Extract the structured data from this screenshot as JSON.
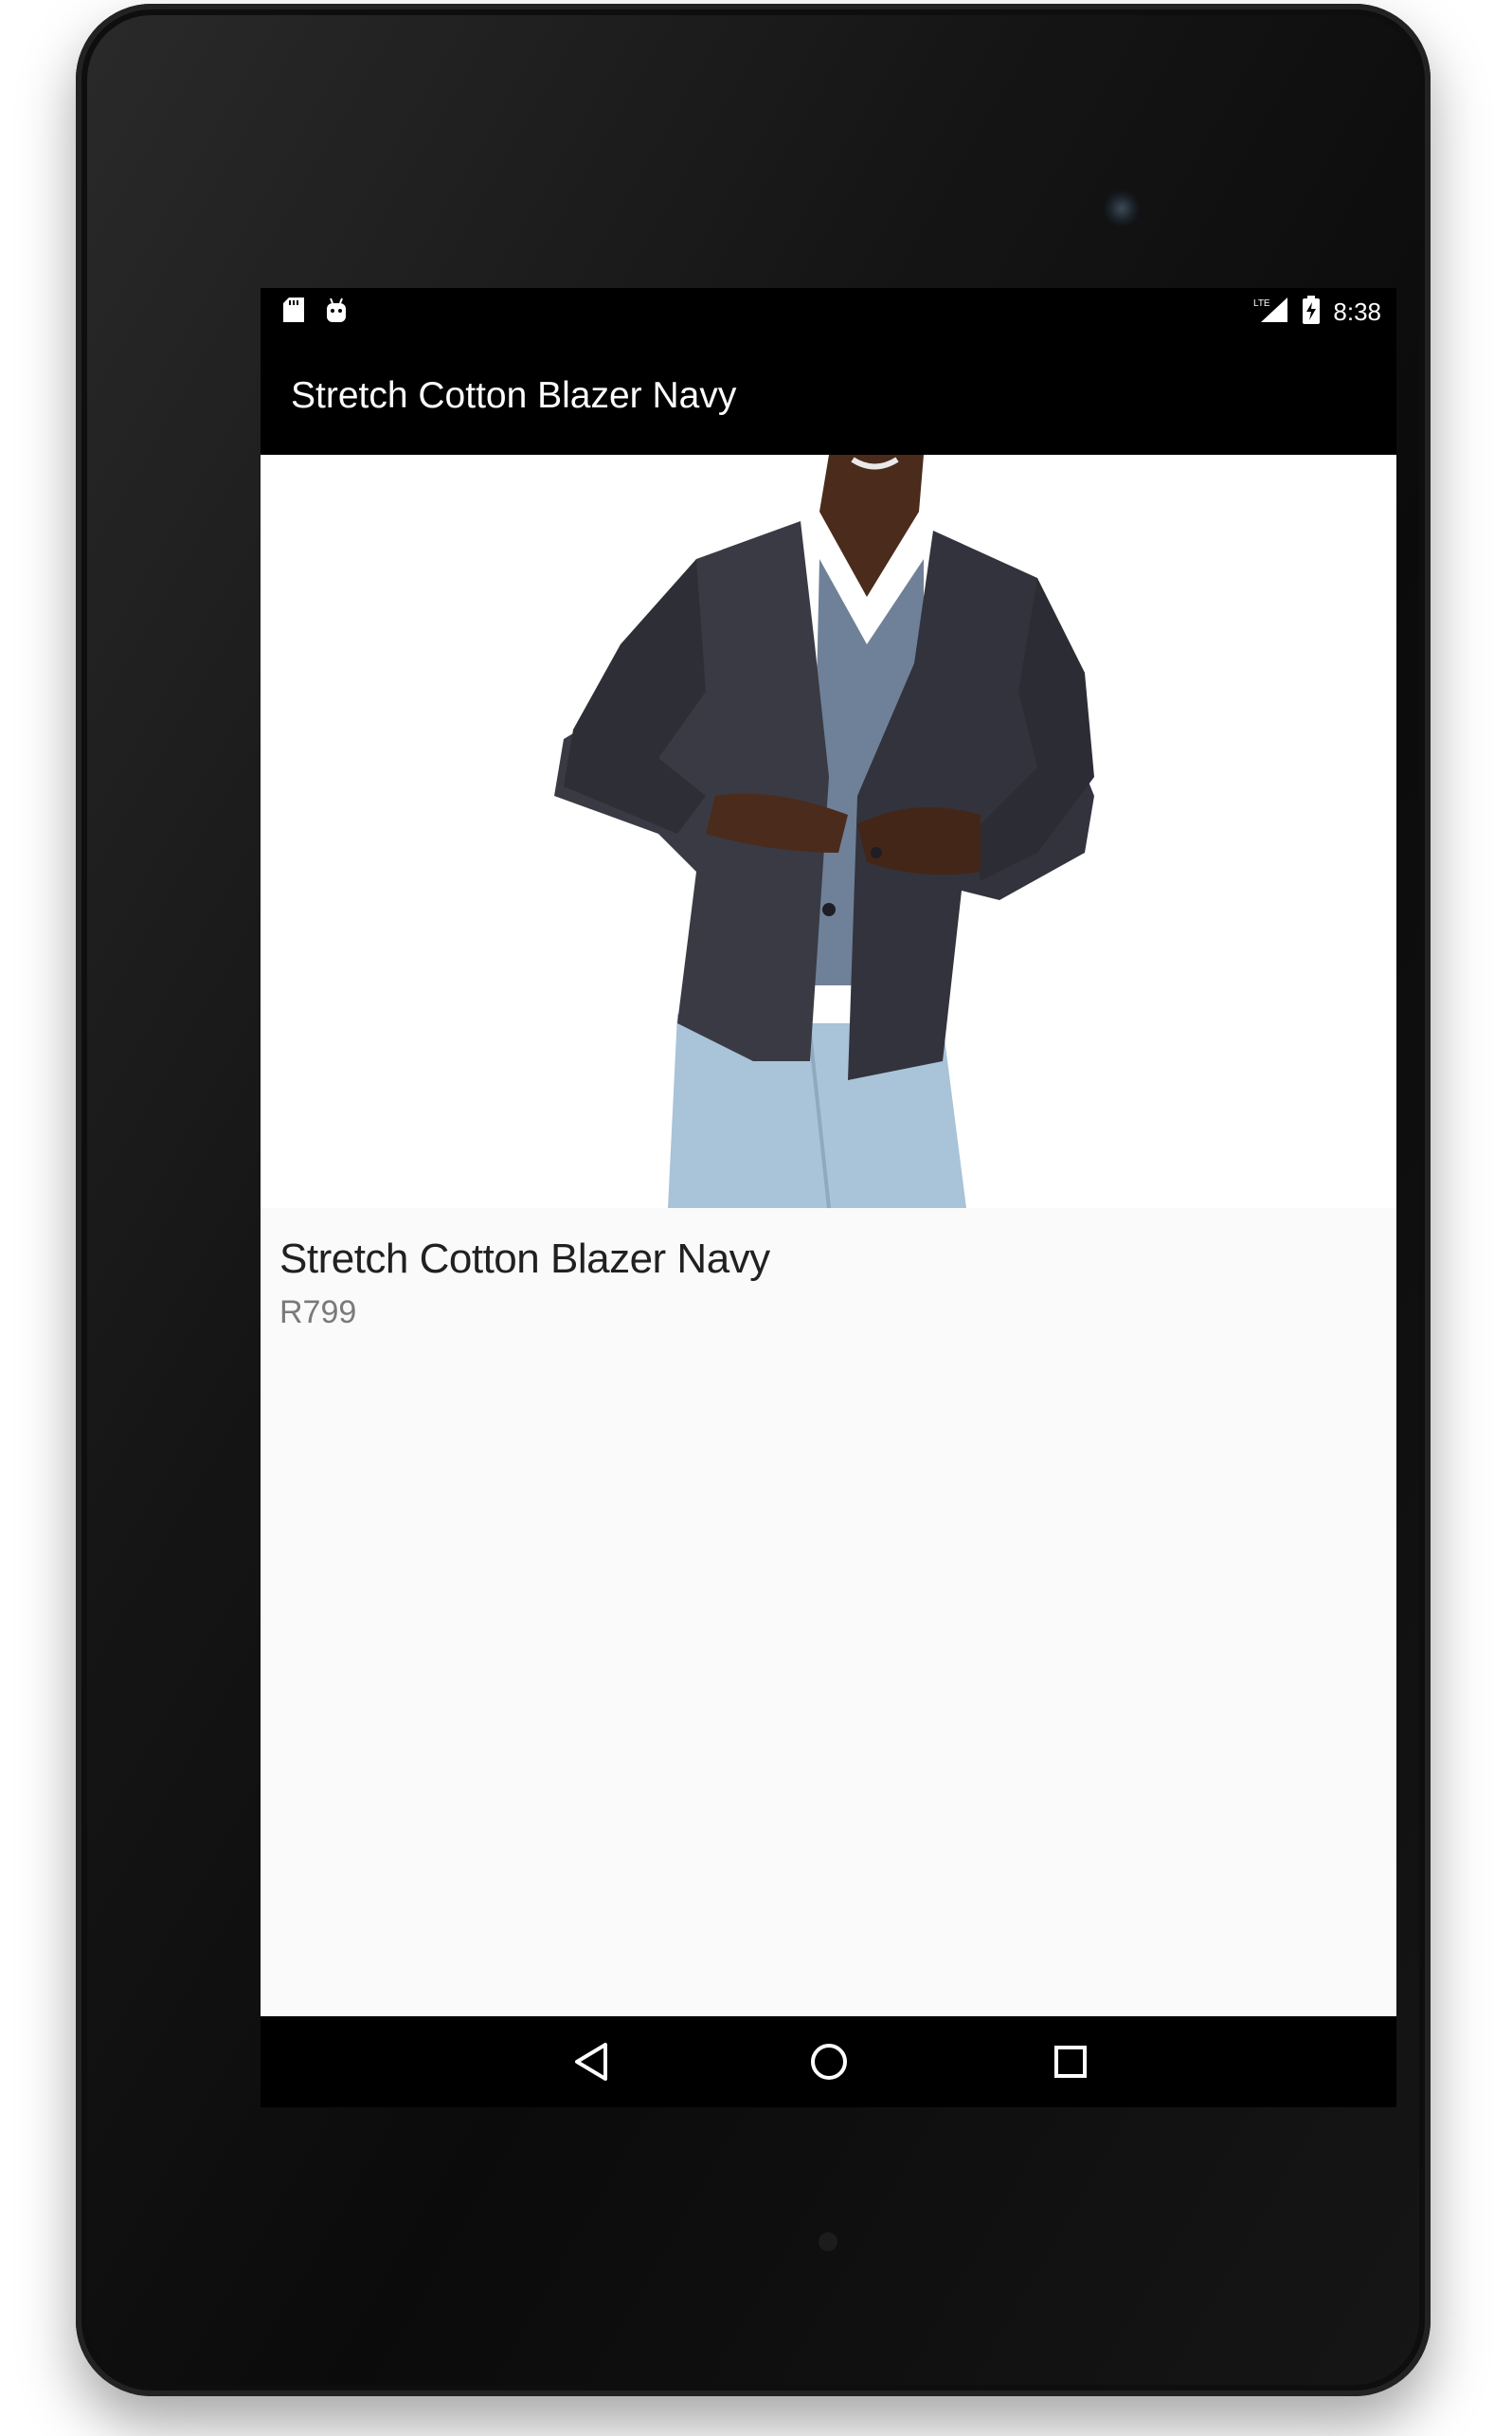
{
  "status_bar": {
    "time": "8:38",
    "left_icons": [
      "sd-card-icon",
      "android-debug-icon"
    ],
    "right_icons": [
      "lte-signal-icon",
      "battery-charging-icon"
    ]
  },
  "app_bar": {
    "title": "Stretch Cotton Blazer Navy"
  },
  "product": {
    "name": "Stretch Cotton Blazer Navy",
    "price": "R799",
    "image_icon": "product-photo"
  },
  "nav_bar": {
    "buttons": [
      "back-icon",
      "home-icon",
      "recents-icon"
    ]
  },
  "colors": {
    "app_bar": "#000000",
    "background": "#fafafa",
    "title_text": "#ffffff",
    "price_text": "#7a7a7a"
  }
}
